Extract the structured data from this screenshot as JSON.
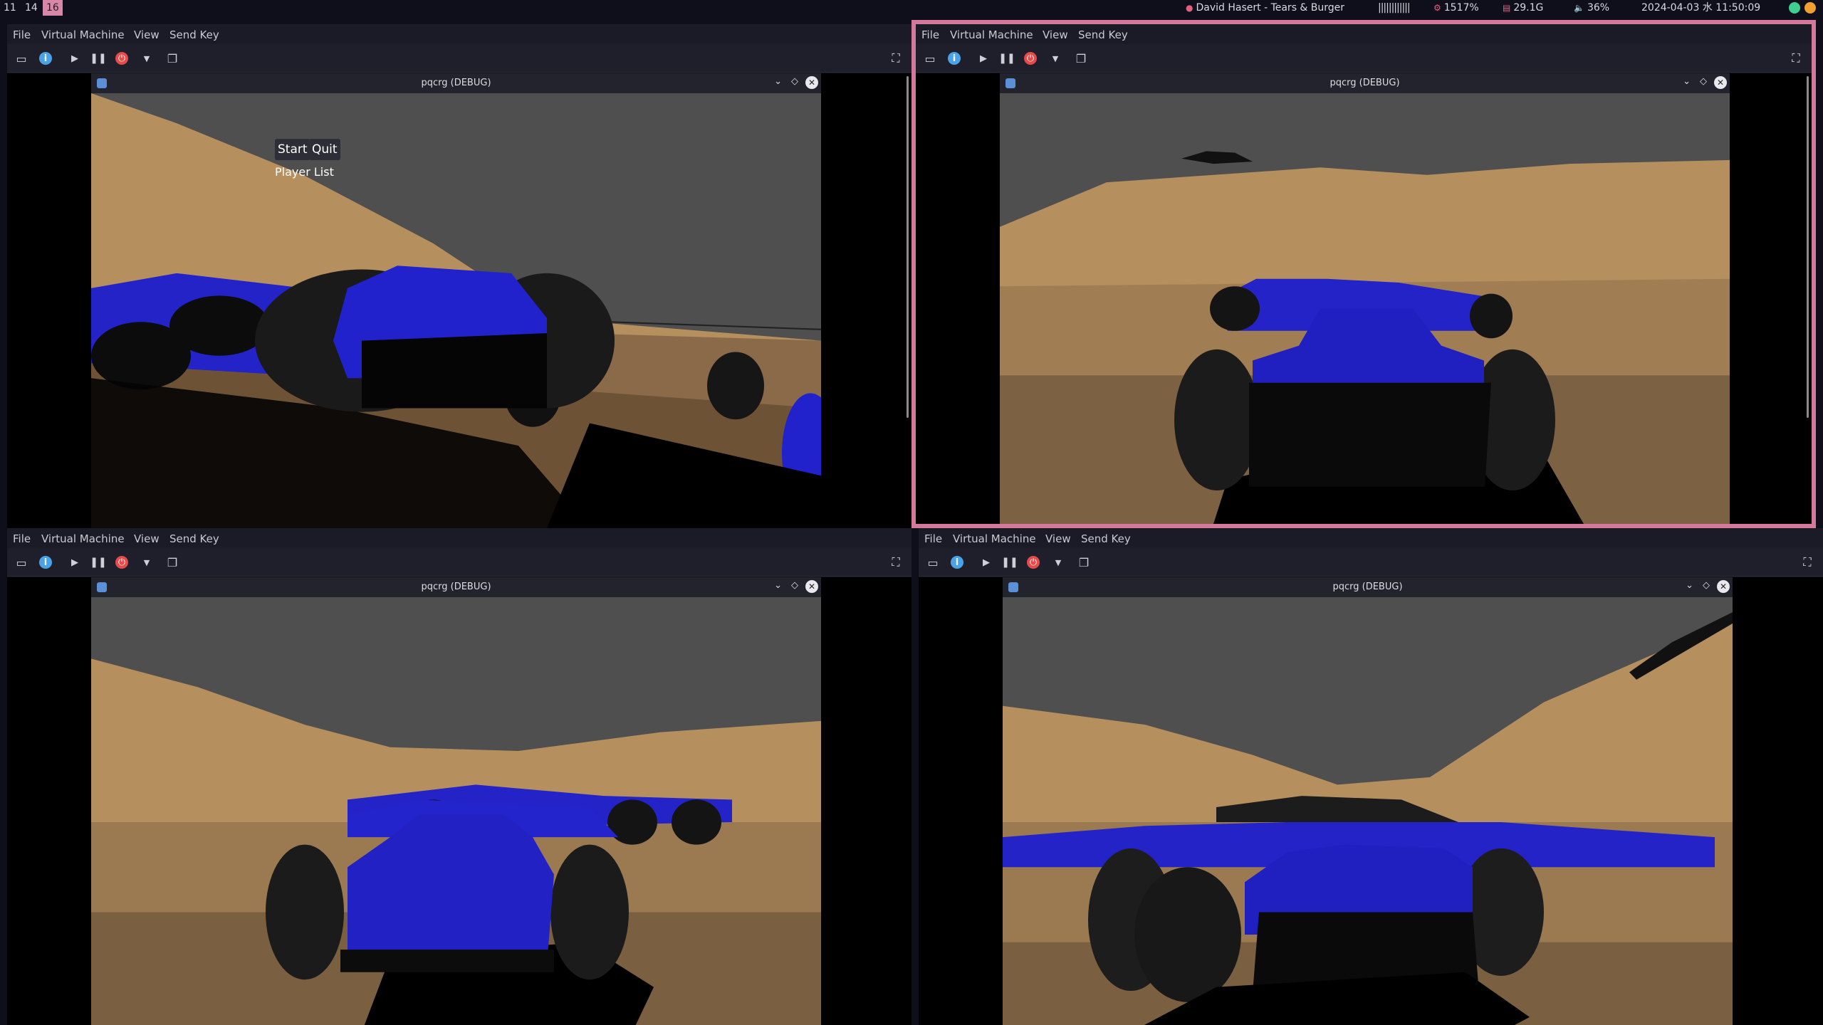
{
  "workspaces": [
    "11",
    "14",
    "16"
  ],
  "active_workspace": "16",
  "status": {
    "music": "David Hasert - Tears & Burger",
    "volume_bars": "||||||||||||",
    "cpu": "1517%",
    "memory": "29.1G",
    "audio": "36%",
    "datetime": "2024-04-03 水 11:50:09"
  },
  "colors": {
    "focus_border": "#d4799c",
    "active_workspace": "#d987a8",
    "sky": "#505050",
    "sand": "#b8925f",
    "car_body": "#2323c8"
  },
  "vm_windows": [
    {
      "menu": [
        "File",
        "Virtual Machine",
        "View",
        "Send Key"
      ],
      "guest_title": "pqcrg (DEBUG)",
      "focused": false,
      "game_ui": {
        "start": "Start",
        "quit": "Quit",
        "player_list": "Player List"
      }
    },
    {
      "menu": [
        "File",
        "Virtual Machine",
        "View",
        "Send Key"
      ],
      "guest_title": "pqcrg (DEBUG)",
      "focused": true
    },
    {
      "menu": [
        "File",
        "Virtual Machine",
        "View",
        "Send Key"
      ],
      "guest_title": "pqcrg (DEBUG)",
      "focused": false
    },
    {
      "menu": [
        "File",
        "Virtual Machine",
        "View",
        "Send Key"
      ],
      "guest_title": "pqcrg (DEBUG)",
      "focused": false
    }
  ],
  "toolbar_icons": [
    "monitor-icon",
    "info-icon",
    "play-icon",
    "pause-icon",
    "power-icon",
    "dropdown-arrow-icon",
    "snapshots-icon",
    "fullscreen-icon"
  ]
}
